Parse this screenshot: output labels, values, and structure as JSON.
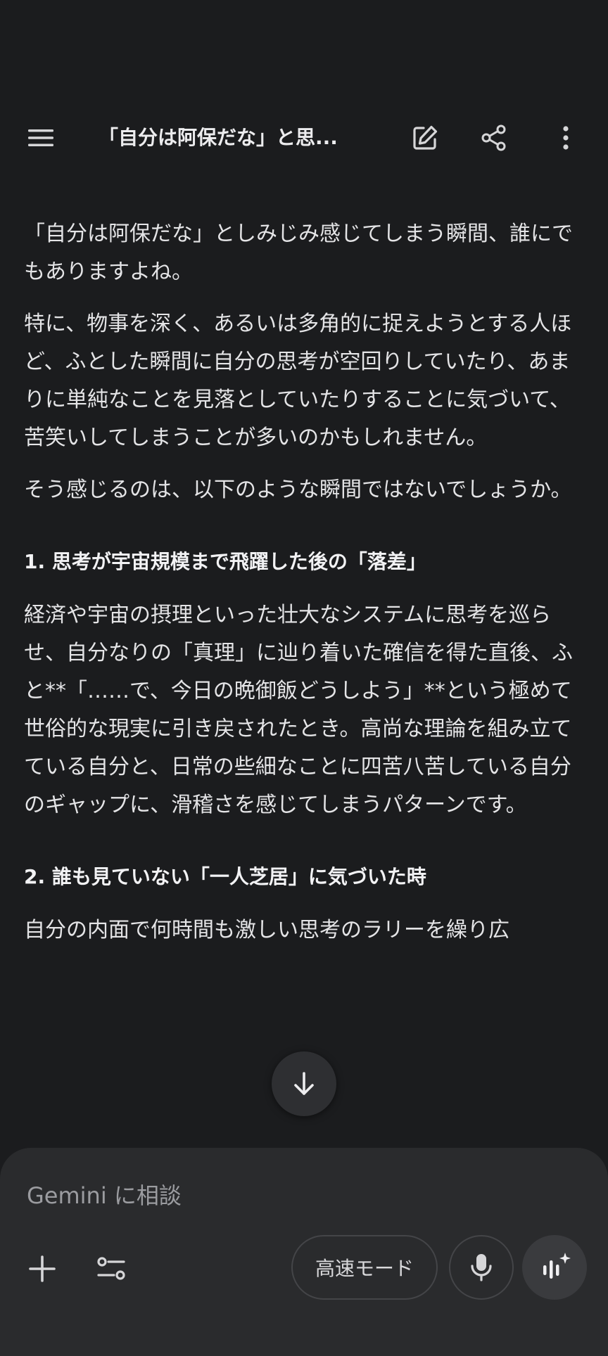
{
  "header": {
    "title": "「自分は阿保だな」と思..."
  },
  "content": {
    "paragraph_1": "「自分は阿保だな」としみじみ感じてしまう瞬間、誰にでもありますよね。",
    "paragraph_2": "特に、物事を深く、あるいは多角的に捉えようとする人ほど、ふとした瞬間に自分の思考が空回りしていたり、あまりに単純なことを見落としていたりすることに気づいて、苦笑いしてしまうことが多いのかもしれません。",
    "paragraph_3": "そう感じるのは、以下のような瞬間ではないでしょうか。",
    "heading_1": "1. 思考が宇宙規模まで飛躍した後の「落差」",
    "paragraph_4": "経済や宇宙の摂理といった壮大なシステムに思考を巡らせ、自分なりの「真理」に辿り着いた確信を得た直後、ふと**「……で、今日の晩御飯どうしよう」**という極めて世俗的な現実に引き戻されたとき。高尚な理論を組み立てている自分と、日常の些細なことに四苦八苦している自分のギャップに、滑稽さを感じてしまうパターンです。",
    "heading_2": "2. 誰も見ていない「一人芝居」に気づいた時",
    "paragraph_5": "自分の内面で何時間も激しい思考のラリーを繰り広"
  },
  "input": {
    "placeholder": "Gemini に相談",
    "mode_label": "高速モード"
  },
  "colors": {
    "background": "#1b1c1e",
    "panel": "#2a2b2d",
    "text": "#e4e4e6",
    "placeholder": "#9b9ca0"
  },
  "icons": [
    "menu-icon",
    "edit-icon",
    "share-icon",
    "more-vert-icon",
    "arrow-down-icon",
    "plus-icon",
    "tools-icon",
    "mic-icon",
    "live-sparkle-icon"
  ]
}
